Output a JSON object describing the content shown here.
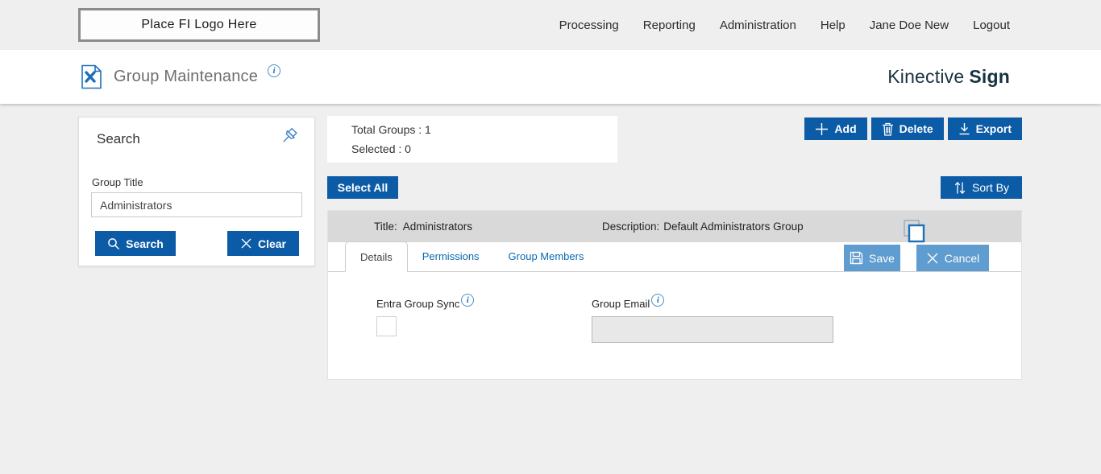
{
  "colors": {
    "primary_blue": "#0b5ba6",
    "light_blue": "#5f9ccf",
    "link_blue": "#0a6ab0",
    "brand_teal": "#17333f",
    "row_gray": "#d9d9d9",
    "page_bg": "#efefef"
  },
  "header": {
    "logo_text": "Place FI Logo Here",
    "nav": [
      "Processing",
      "Reporting",
      "Administration",
      "Help",
      "Jane Doe New",
      "Logout"
    ]
  },
  "page_header": {
    "title": "Group Maintenance",
    "info_icon": "i",
    "brand_regular": "Kinective",
    "brand_bold": "Sign"
  },
  "search_panel": {
    "title": "Search",
    "group_title_label": "Group Title",
    "group_title_value": "Administrators",
    "search_button": "Search",
    "clear_button": "Clear"
  },
  "toolbar": {
    "total_groups": "Total Groups : 1",
    "selected": "Selected : 0",
    "add_label": "Add",
    "delete_label": "Delete",
    "export_label": "Export",
    "select_all_label": "Select All",
    "sort_by_label": "Sort By"
  },
  "group": {
    "title_label": "Title:",
    "title_value": "Administrators",
    "description_label": "Description:",
    "description_value": "Default Administrators Group",
    "tabs": [
      "Details",
      "Permissions",
      "Group Members"
    ],
    "save_label": "Save",
    "cancel_label": "Cancel",
    "details": {
      "entra_label": "Entra Group Sync",
      "email_label": "Group Email",
      "email_value": ""
    }
  }
}
